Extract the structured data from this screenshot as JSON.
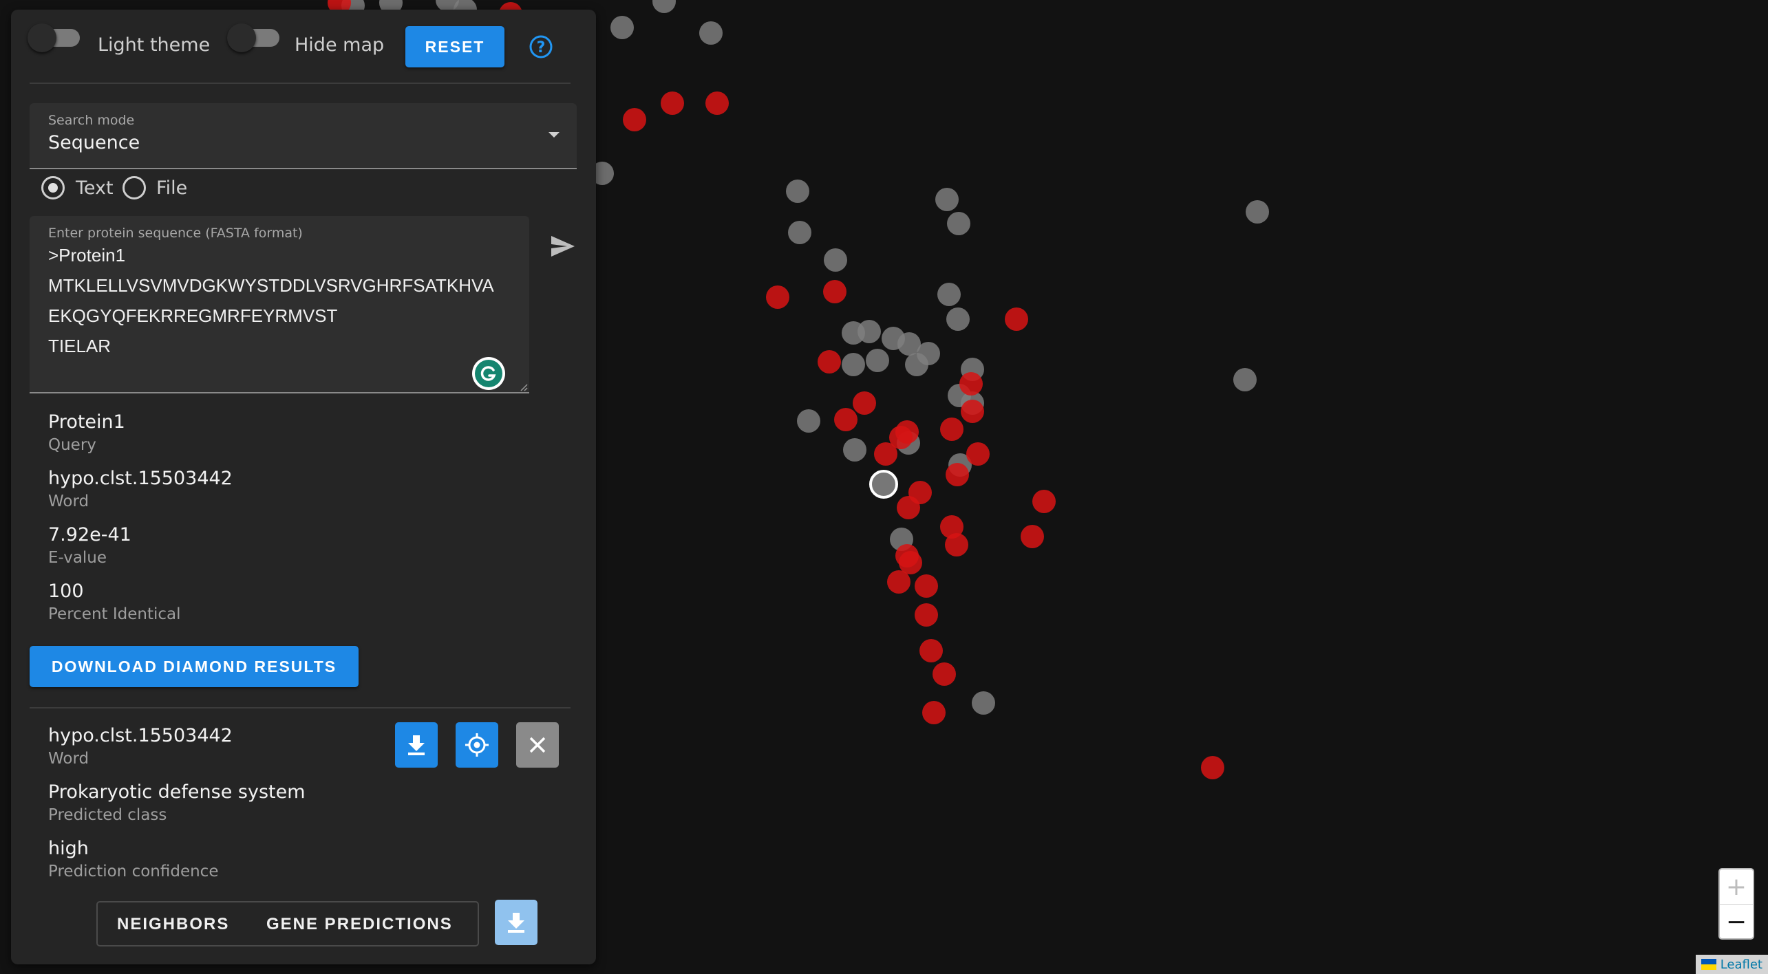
{
  "controls": {
    "light_theme_label": "Light theme",
    "hide_map_label": "Hide map",
    "reset_label": "RESET",
    "help_icon": "help-circle-icon"
  },
  "search": {
    "mode_label": "Search mode",
    "mode_value": "Sequence",
    "input_type_options": [
      {
        "label": "Text",
        "selected": true
      },
      {
        "label": "File",
        "selected": false
      }
    ],
    "sequence_label": "Enter protein sequence (FASTA format)",
    "sequence_lines": [
      ">Protein1",
      "MTKLELLVSVMVDGKWYSTDDLVSRVGHRFSATKHVA",
      "EKQGYQFEKRREGMRFEYRMVST",
      "TIELAR"
    ]
  },
  "query_result": [
    {
      "value": "Protein1",
      "label": "Query"
    },
    {
      "value": "hypo.clst.15503442",
      "label": "Word"
    },
    {
      "value": "7.92e-41",
      "label": "E-value"
    },
    {
      "value": "100",
      "label": "Percent Identical"
    }
  ],
  "download_diamond_label": "DOWNLOAD DIAMOND RESULTS",
  "selected_word": [
    {
      "value": "hypo.clst.15503442",
      "label": "Word"
    },
    {
      "value": "Prokaryotic defense system",
      "label": "Predicted class"
    },
    {
      "value": "high",
      "label": "Prediction confidence"
    }
  ],
  "tabs": {
    "neighbors_label": "NEIGHBORS",
    "gene_predictions_label": "GENE PREDICTIONS"
  },
  "map": {
    "zoom_in": "+",
    "zoom_out": "−",
    "attribution": "Leaflet",
    "colors": {
      "background": "#121212",
      "grey_point": "#808080",
      "red_point": "#d61414",
      "accent": "#1e88e5"
    }
  }
}
